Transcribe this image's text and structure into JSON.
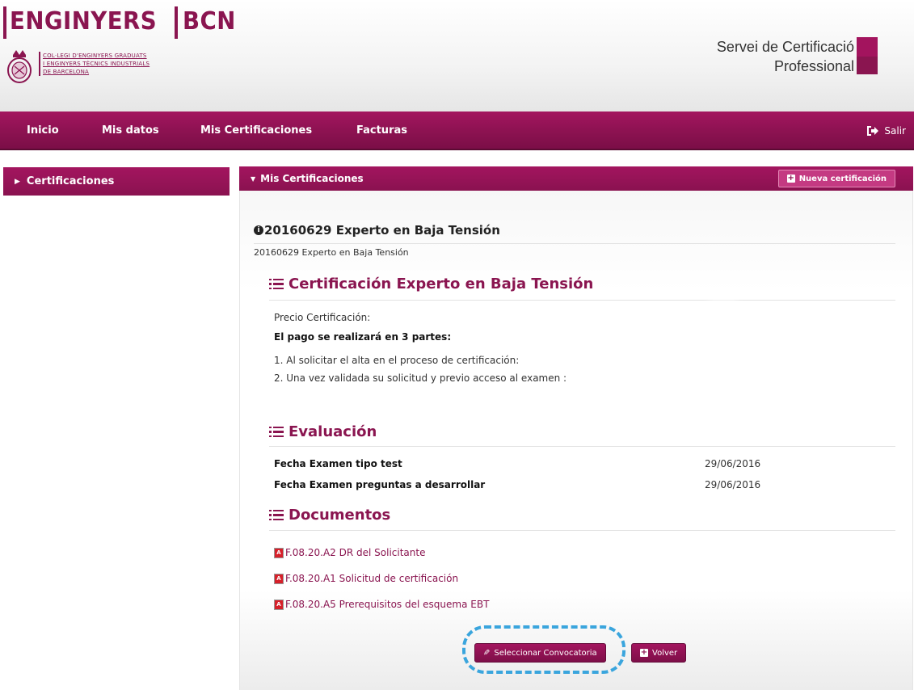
{
  "header": {
    "brand_left": "ENGINYERS",
    "brand_right": "BCN",
    "college_lines": [
      "COL·LEGI D'ENGINYERS GRADUATS",
      "I ENGINYERS TÈCNICS INDUSTRIALS",
      "DE BARCELONA"
    ],
    "service_line1": "Servei de Certificació",
    "service_line2": "Professional"
  },
  "nav": {
    "items": [
      "Inicio",
      "Mis datos",
      "Mis Certificaciones",
      "Facturas"
    ],
    "logout": "Salir"
  },
  "sidebar": {
    "items": [
      {
        "label": "Certificaciones"
      }
    ]
  },
  "panel": {
    "title": "Mis Certificaciones",
    "new_button": "Nueva certificación"
  },
  "certification": {
    "title": "20160629 Experto en Baja Tensión",
    "subtitle": "20160629 Experto en Baja Tensión"
  },
  "section_cert": {
    "title": "Certificación Experto en Baja Tensión",
    "price_label": "Precio Certificación:",
    "payment_note": "El pago se realizará en 3 partes:",
    "steps": [
      "1. Al solicitar el alta en el proceso de certificación:",
      "2. Una vez validada su solicitud y previo acceso al examen :"
    ]
  },
  "section_eval": {
    "title": "Evaluación",
    "rows": [
      {
        "label": "Fecha Examen tipo test",
        "date": "29/06/2016"
      },
      {
        "label": "Fecha Examen preguntas a desarrollar",
        "date": "29/06/2016"
      }
    ]
  },
  "section_docs": {
    "title": "Documentos",
    "documents": [
      "F.08.20.A2 DR del Solicitante",
      "F.08.20.A1 Solicitud de certificación",
      "F.08.20.A5 Prerequisitos del esquema EBT"
    ]
  },
  "actions": {
    "select": "Seleccionar Convocatoria",
    "back": "Volver"
  },
  "colors": {
    "brand": "#8a1550",
    "highlight": "#3aa5dd"
  }
}
